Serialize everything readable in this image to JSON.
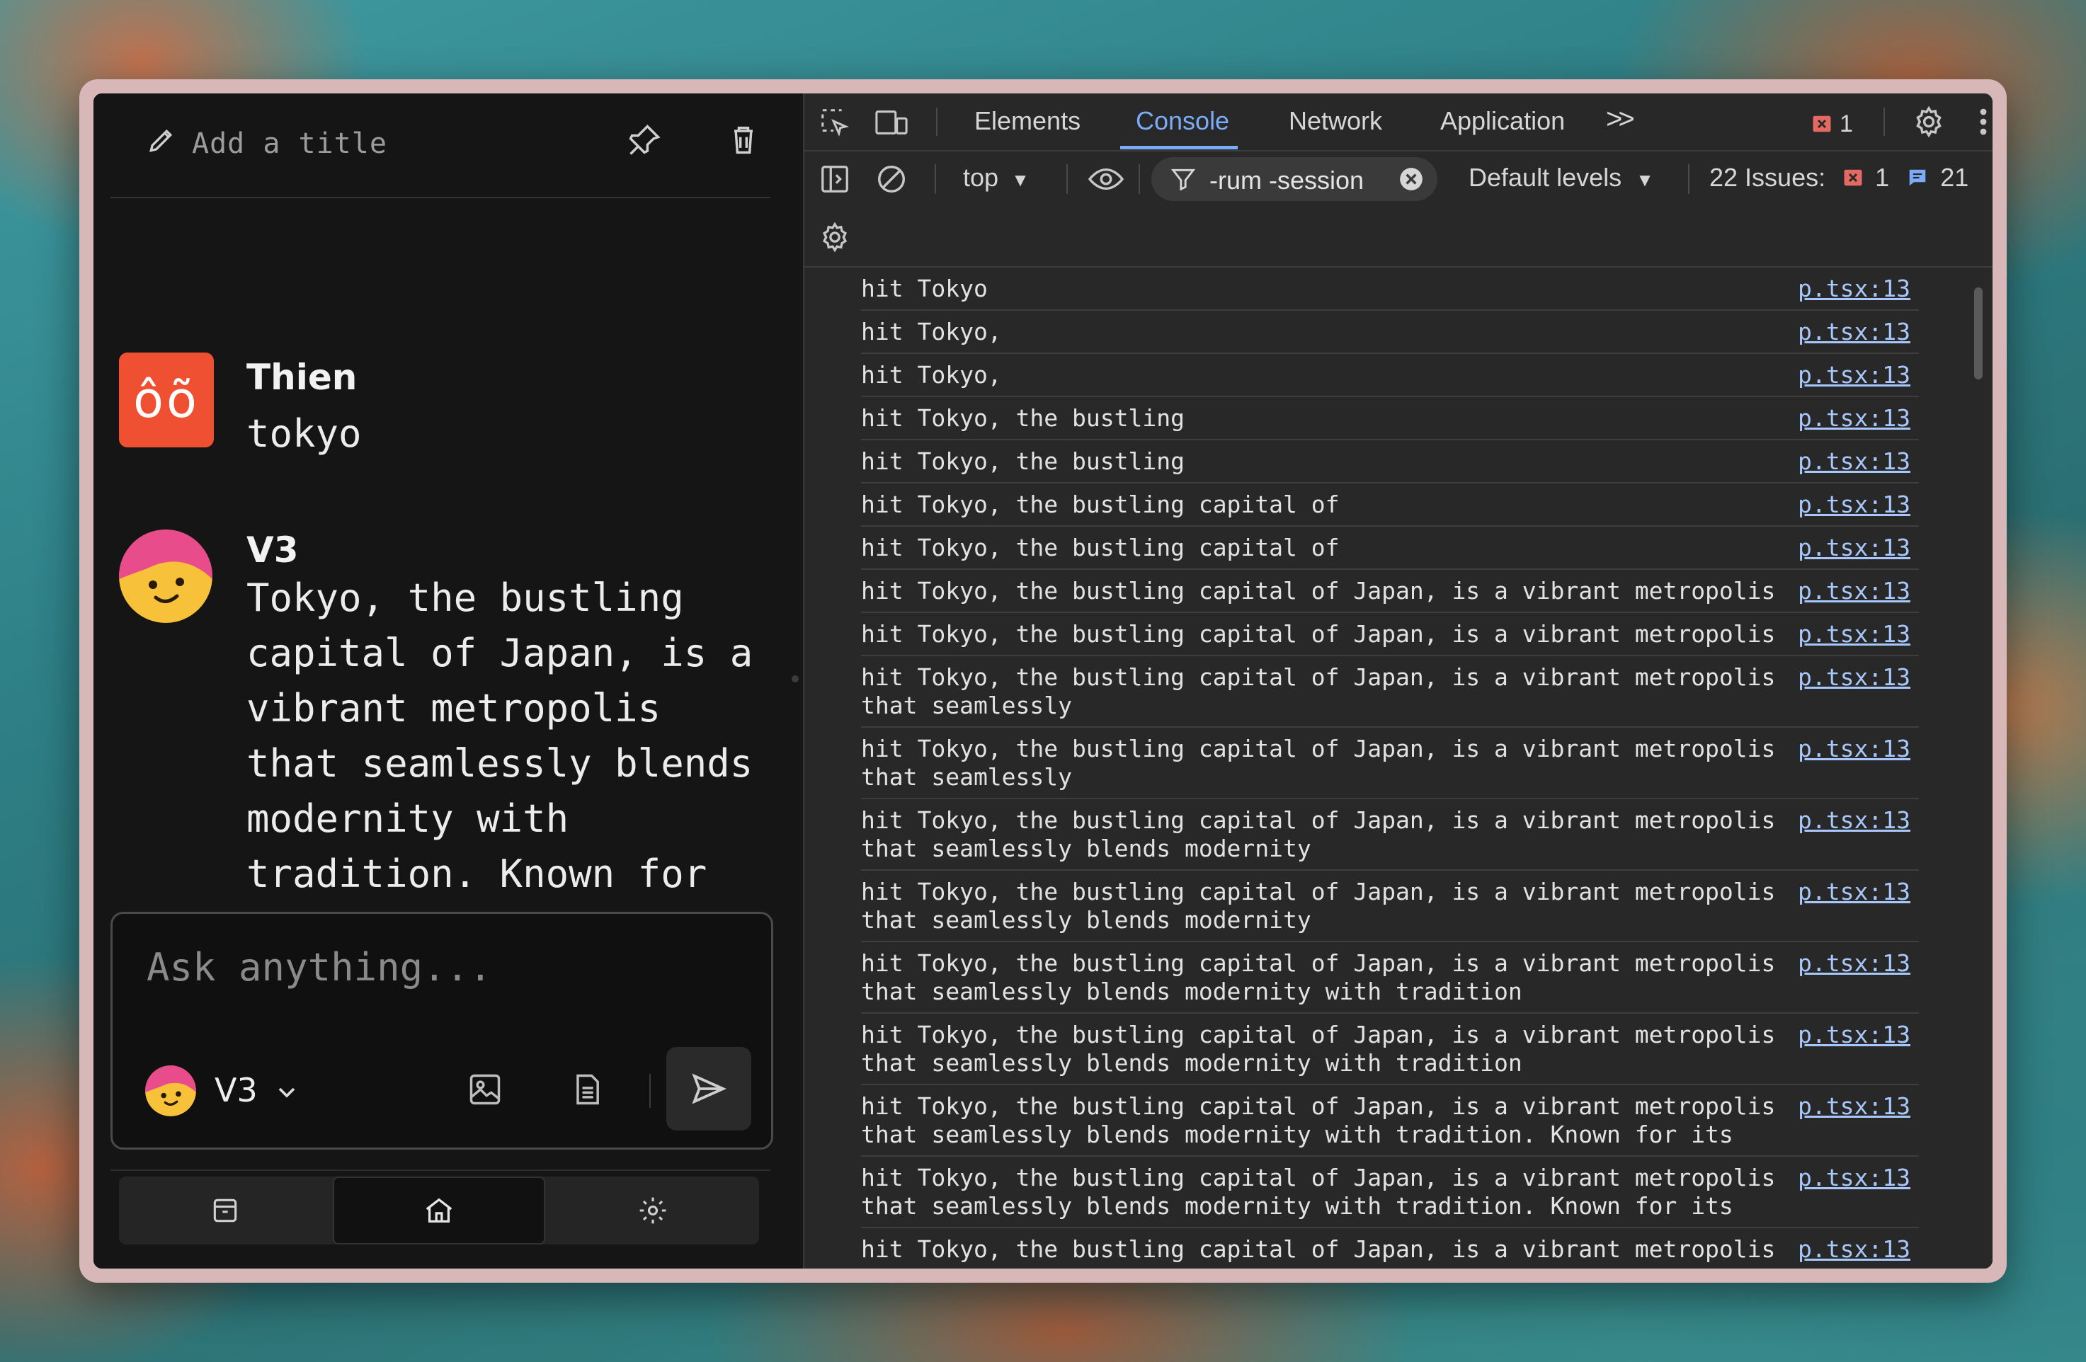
{
  "chat": {
    "title_placeholder": "Add a title",
    "messages": [
      {
        "author": "Thien",
        "avatar_text": "ôõ",
        "text": "tokyo"
      },
      {
        "author": "V3",
        "text": "Tokyo, the bustling capital of Japan, is a vibrant metropolis that seamlessly blends modernity with tradition. Known for its towering skyscrapers, cutting-edge technology, and"
      }
    ],
    "input": {
      "placeholder": "Ask anything..."
    },
    "model": {
      "name": "V3"
    },
    "nav": [
      "archive",
      "home",
      "settings"
    ],
    "colors": {
      "avatar_red": "#f05032",
      "accent_pink": "#e94c8a",
      "face_yellow": "#f7c23a"
    }
  },
  "devtools": {
    "tabs": [
      "Elements",
      "Console",
      "Network",
      "Application"
    ],
    "active_tab": "Console",
    "more_tabs": ">>",
    "error_count": "1",
    "context": "top",
    "filter": "-rum -session",
    "levels": "Default levels",
    "issues_label": "22 Issues:",
    "issues_errors": "1",
    "issues_info": "21",
    "logs": [
      {
        "msg": "hit Tokyo",
        "src": "p.tsx:13"
      },
      {
        "msg": "hit Tokyo,",
        "src": "p.tsx:13"
      },
      {
        "msg": "hit Tokyo,",
        "src": "p.tsx:13"
      },
      {
        "msg": "hit Tokyo, the bustling",
        "src": "p.tsx:13"
      },
      {
        "msg": "hit Tokyo, the bustling",
        "src": "p.tsx:13"
      },
      {
        "msg": "hit Tokyo, the bustling capital of",
        "src": "p.tsx:13"
      },
      {
        "msg": "hit Tokyo, the bustling capital of",
        "src": "p.tsx:13"
      },
      {
        "msg": "hit Tokyo, the bustling capital of Japan, is a vibrant metropolis",
        "src": "p.tsx:13"
      },
      {
        "msg": "hit Tokyo, the bustling capital of Japan, is a vibrant metropolis",
        "src": "p.tsx:13"
      },
      {
        "msg": "hit Tokyo, the bustling capital of Japan, is a vibrant metropolis that seamlessly",
        "src": "p.tsx:13"
      },
      {
        "msg": "hit Tokyo, the bustling capital of Japan, is a vibrant metropolis that seamlessly",
        "src": "p.tsx:13"
      },
      {
        "msg": "hit Tokyo, the bustling capital of Japan, is a vibrant metropolis that seamlessly blends modernity",
        "src": "p.tsx:13"
      },
      {
        "msg": "hit Tokyo, the bustling capital of Japan, is a vibrant metropolis that seamlessly blends modernity",
        "src": "p.tsx:13"
      },
      {
        "msg": "hit Tokyo, the bustling capital of Japan, is a vibrant metropolis that seamlessly blends modernity with tradition",
        "src": "p.tsx:13"
      },
      {
        "msg": "hit Tokyo, the bustling capital of Japan, is a vibrant metropolis that seamlessly blends modernity with tradition",
        "src": "p.tsx:13"
      },
      {
        "msg": "hit Tokyo, the bustling capital of Japan, is a vibrant metropolis that seamlessly blends modernity with tradition. Known for its",
        "src": "p.tsx:13"
      },
      {
        "msg": "hit Tokyo, the bustling capital of Japan, is a vibrant metropolis that seamlessly blends modernity with tradition. Known for its",
        "src": "p.tsx:13"
      },
      {
        "msg": "hit Tokyo, the bustling capital of Japan, is a vibrant metropolis",
        "src": "p.tsx:13"
      }
    ],
    "colors": {
      "accent": "#7cacf8",
      "link": "#a8c7fa",
      "error": "#e46962"
    }
  }
}
